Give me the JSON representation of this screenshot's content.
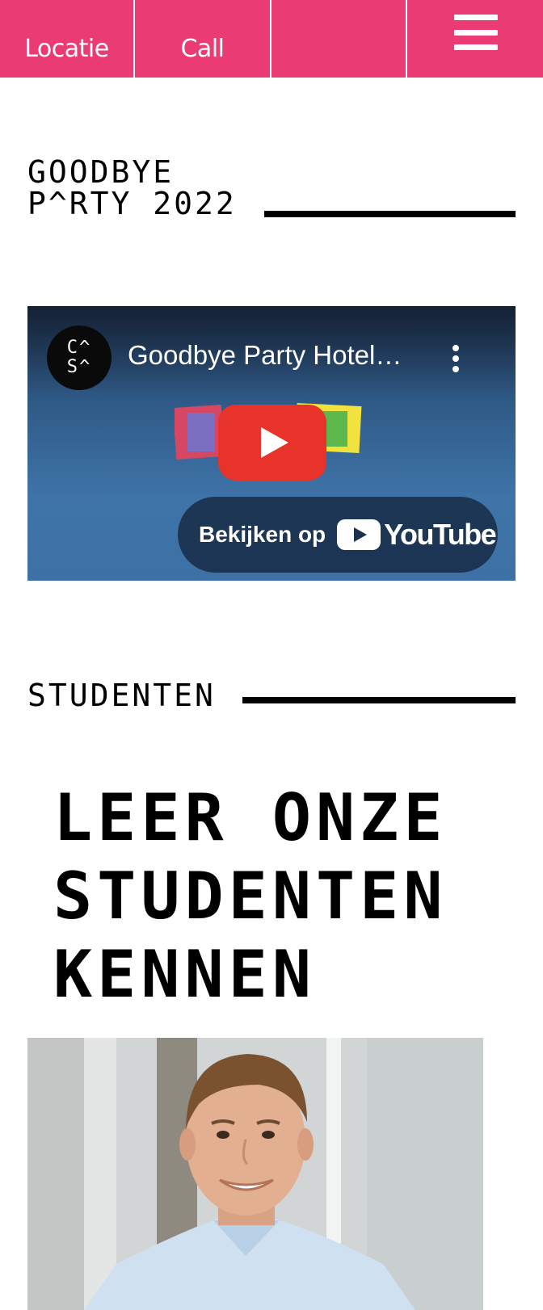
{
  "nav": {
    "location_label": "Locatie",
    "call_label": "Call",
    "empty_label": "",
    "menu_icon": "hamburger-menu-icon",
    "background_color": "#ea3b73"
  },
  "section_goodbye": {
    "heading_line1": "GOODBYE",
    "heading_line2": "P^RTY 2022"
  },
  "video": {
    "channel_avatar_line1": "C^",
    "channel_avatar_line2": "S^",
    "title": "Goodbye Party Hotel…",
    "menu_icon": "more-vertical-icon",
    "play_icon": "play-icon",
    "watch_label": "Bekijken op",
    "youtube_wordmark": "YouTube",
    "play_button_color": "#e8332a"
  },
  "section_students": {
    "heading": "STUDENTEN",
    "big_heading_line1": "LEER ONZE",
    "big_heading_line2": "STUDENTEN",
    "big_heading_line3": "KENNEN"
  }
}
